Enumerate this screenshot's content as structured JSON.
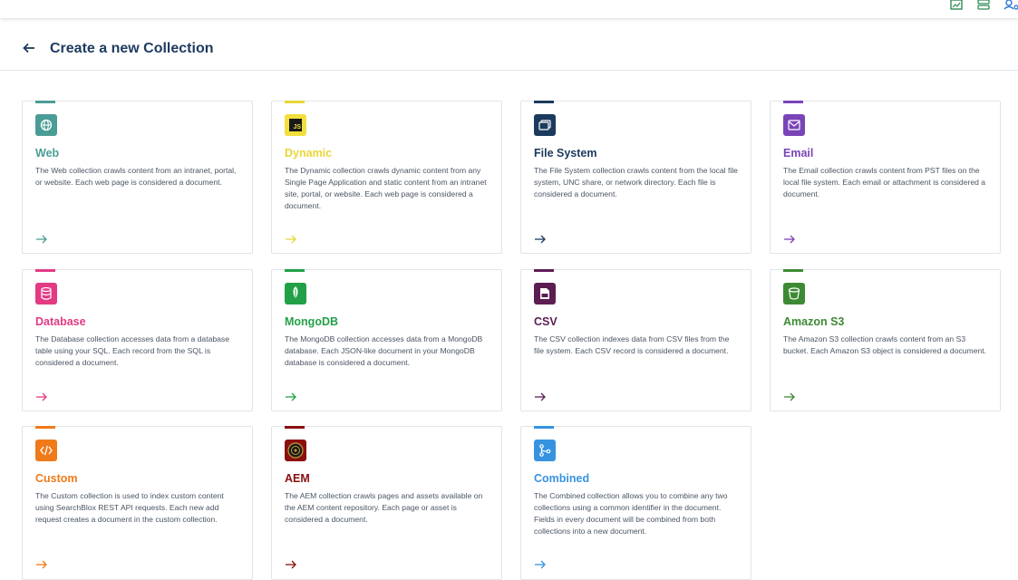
{
  "header": {
    "title": "Create a new Collection"
  },
  "cards": [
    {
      "title": "Web",
      "description": "The Web collection crawls content from an intranet, portal, or website. Each web page is considered a document.",
      "color": "#4a9d96",
      "icon": "globe-icon"
    },
    {
      "title": "Dynamic",
      "description": "The Dynamic collection crawls dynamic content from any Single Page Application and static content from an intranet site, portal, or website. Each web page is considered a document.",
      "color": "#e8d638",
      "icon": "js-icon",
      "icon_text": "JS"
    },
    {
      "title": "File System",
      "description": "The File System collection crawls content from the local file system, UNC share, or network directory. Each file is considered a document.",
      "color": "#1b3a5e",
      "icon": "folder-icon"
    },
    {
      "title": "Email",
      "description": "The Email collection crawls content from PST files on the local file system. Each email or attachment is considered a document.",
      "color": "#7a44b8",
      "icon": "mail-icon"
    },
    {
      "title": "Database",
      "description": "The Database collection accesses data from a database table using your SQL. Each record from the SQL is considered a document.",
      "color": "#e23b84",
      "icon": "database-icon"
    },
    {
      "title": "MongoDB",
      "description": "The MongoDB collection accesses data from a MongoDB database. Each JSON-like document in your MongoDB database is considered a document.",
      "color": "#22a048",
      "icon": "mongodb-leaf-icon"
    },
    {
      "title": "CSV",
      "description": "The CSV collection indexes data from CSV files from the file system. Each CSV record is considered a document.",
      "color": "#5c1e52",
      "icon": "csv-file-icon"
    },
    {
      "title": "Amazon S3",
      "description": "The Amazon S3 collection crawls content from an S3 bucket. Each Amazon S3 object is considered a document.",
      "color": "#3d8a34",
      "icon": "bucket-icon"
    },
    {
      "title": "Custom",
      "description": "The Custom collection is used to index custom content using SearchBlox REST API requests. Each new add request creates a document in the custom collection.",
      "color": "#f07a1a",
      "icon": "code-icon"
    },
    {
      "title": "AEM",
      "description": "The AEM collection crawls pages and assets available on the AEM content repository. Each page or asset is considered a document.",
      "color": "#8a0f0f",
      "icon": "aem-icon"
    },
    {
      "title": "Combined",
      "description": "The Combined collection allows you to combine any two collections using a common identifier in the document. Fields in every document will be combined from both collections into a new document.",
      "color": "#3793e0",
      "icon": "merge-icon"
    }
  ]
}
